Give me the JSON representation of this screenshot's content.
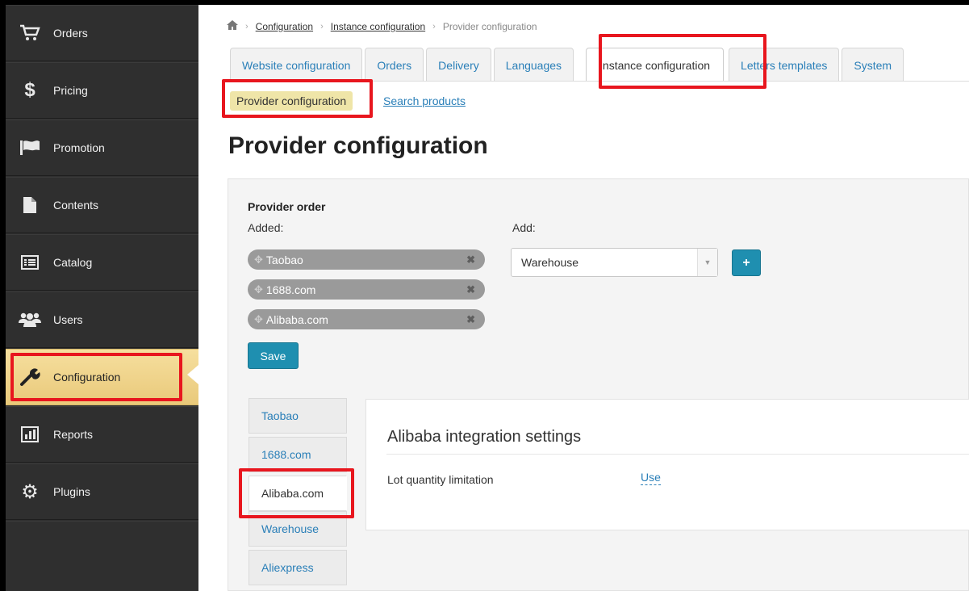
{
  "sidebar": {
    "items": [
      {
        "label": "Orders",
        "icon": "cart-icon"
      },
      {
        "label": "Pricing",
        "icon": "dollar-icon"
      },
      {
        "label": "Promotion",
        "icon": "flag-icon"
      },
      {
        "label": "Contents",
        "icon": "document-icon"
      },
      {
        "label": "Catalog",
        "icon": "list-icon"
      },
      {
        "label": "Users",
        "icon": "users-icon"
      },
      {
        "label": "Configuration",
        "icon": "wrench-icon",
        "active": true
      },
      {
        "label": "Reports",
        "icon": "bar-chart-icon"
      },
      {
        "label": "Plugins",
        "icon": "gear-icon"
      }
    ]
  },
  "breadcrumb": {
    "home_icon": "home-icon",
    "items": [
      "Configuration",
      "Instance configuration",
      "Provider configuration"
    ]
  },
  "tabs": [
    {
      "label": "Website configuration"
    },
    {
      "label": "Orders"
    },
    {
      "label": "Delivery"
    },
    {
      "label": "Languages"
    },
    {
      "label": "Instance configuration",
      "active": true
    },
    {
      "label": "Letters templates"
    },
    {
      "label": "System"
    }
  ],
  "subnav": {
    "active": "Provider configuration",
    "link": "Search products"
  },
  "page_title": "Provider configuration",
  "provider_order": {
    "heading": "Provider order",
    "added_label": "Added:",
    "add_label": "Add:",
    "added": [
      "Taobao",
      "1688.com",
      "Alibaba.com"
    ],
    "select_value": "Warehouse",
    "save_label": "Save",
    "plus_label": "+"
  },
  "provider_tabs": [
    {
      "label": "Taobao"
    },
    {
      "label": "1688.com"
    },
    {
      "label": "Alibaba.com",
      "active": true
    },
    {
      "label": "Warehouse"
    },
    {
      "label": "Aliexpress"
    }
  ],
  "settings": {
    "title": "Alibaba integration settings",
    "rows": [
      {
        "label": "Lot quantity limitation",
        "value": "Use"
      }
    ]
  },
  "colors": {
    "sidebar_bg": "#2f2f2f",
    "active_item": "#efd58c",
    "link": "#2a7fb8",
    "button": "#1f8fb0",
    "highlight": "#e8161e"
  }
}
